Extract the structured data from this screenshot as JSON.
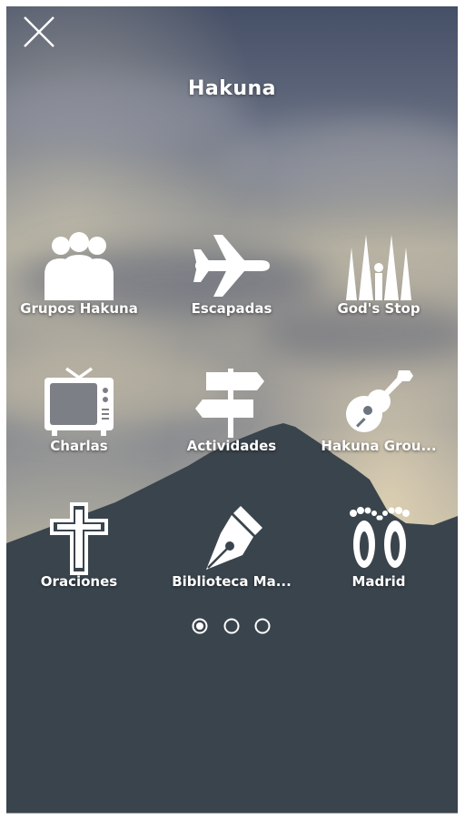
{
  "app": {
    "title": "Hakuna"
  },
  "menu": {
    "items": [
      {
        "label": "Grupos Hakuna",
        "icon": "people-group-icon"
      },
      {
        "label": "Escapadas",
        "icon": "airplane-icon"
      },
      {
        "label": "God's Stop",
        "icon": "cathedral-icon"
      },
      {
        "label": "Charlas",
        "icon": "tv-icon"
      },
      {
        "label": "Actividades",
        "icon": "signpost-icon"
      },
      {
        "label": "Hakuna Grou...",
        "icon": "guitar-icon"
      },
      {
        "label": "Oraciones",
        "icon": "cross-icon"
      },
      {
        "label": "Biblioteca Ma...",
        "icon": "fountain-pen-icon"
      },
      {
        "label": "Madrid",
        "icon": "footprints-icon"
      }
    ]
  },
  "pagination": {
    "pages": 3,
    "current": 1
  },
  "colors": {
    "mountain": "#3a444d",
    "text": "#ffffff"
  }
}
